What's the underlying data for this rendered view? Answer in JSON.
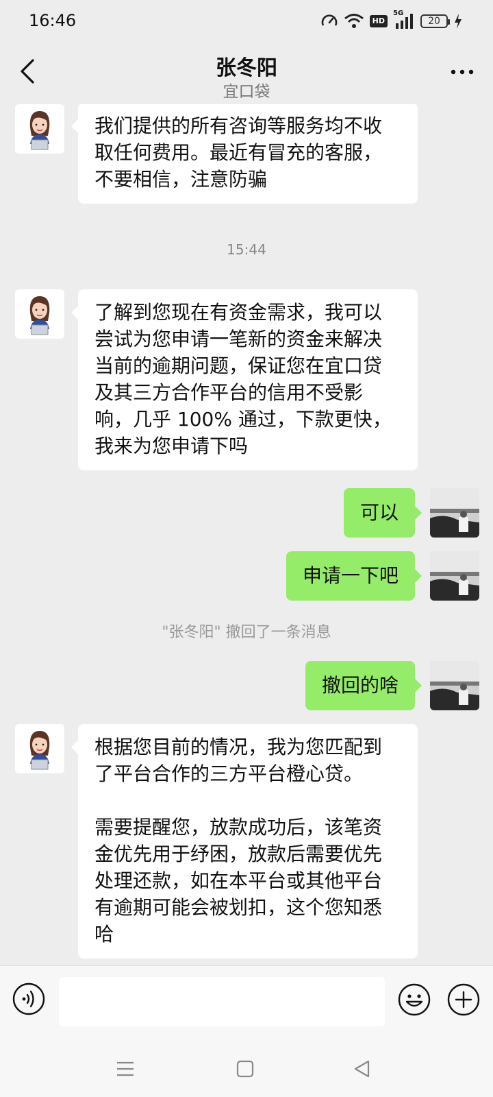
{
  "status_bar": {
    "time": "16:46",
    "hd_label": "HD",
    "network_label": "5G",
    "battery_level": "20"
  },
  "header": {
    "title": "张冬阳",
    "subtitle": "宜口袋"
  },
  "messages": [
    {
      "side": "left",
      "text": "我们提供的所有咨询等服务均不收\n取任何费用。最近有冒充的客服，\n不要相信，注意防骗"
    },
    {
      "type": "time",
      "text": "15:44"
    },
    {
      "side": "left",
      "text": "了解到您现在有资金需求，我可以\n尝试为您申请一笔新的资金来解决\n当前的逾期问题，保证您在宜口贷\n及其三方合作平台的信用不受影\n响，几乎 100% 通过，下款更快，\n我来为您申请下吗"
    },
    {
      "side": "right",
      "text": "可以"
    },
    {
      "side": "right",
      "text": "申请一下吧"
    },
    {
      "type": "system",
      "text": "\"张冬阳\" 撤回了一条消息"
    },
    {
      "side": "right",
      "text": "撤回的啥"
    },
    {
      "side": "left",
      "text": "根据您目前的情况，我为您匹配到\n了平台合作的三方平台橙心贷。\n\n需要提醒您，放款成功后，该笔资\n金优先用于纾困，放款后需要优先\n处理还款，如在本平台或其他平台\n有逾期可能会被划扣，这个您知悉\n哈"
    }
  ],
  "input": {
    "placeholder": ""
  },
  "icons": {
    "back": "back-arrow-icon",
    "more": "more-dots-icon",
    "voice": "voice-icon",
    "emoji": "emoji-icon",
    "plus": "plus-icon"
  }
}
